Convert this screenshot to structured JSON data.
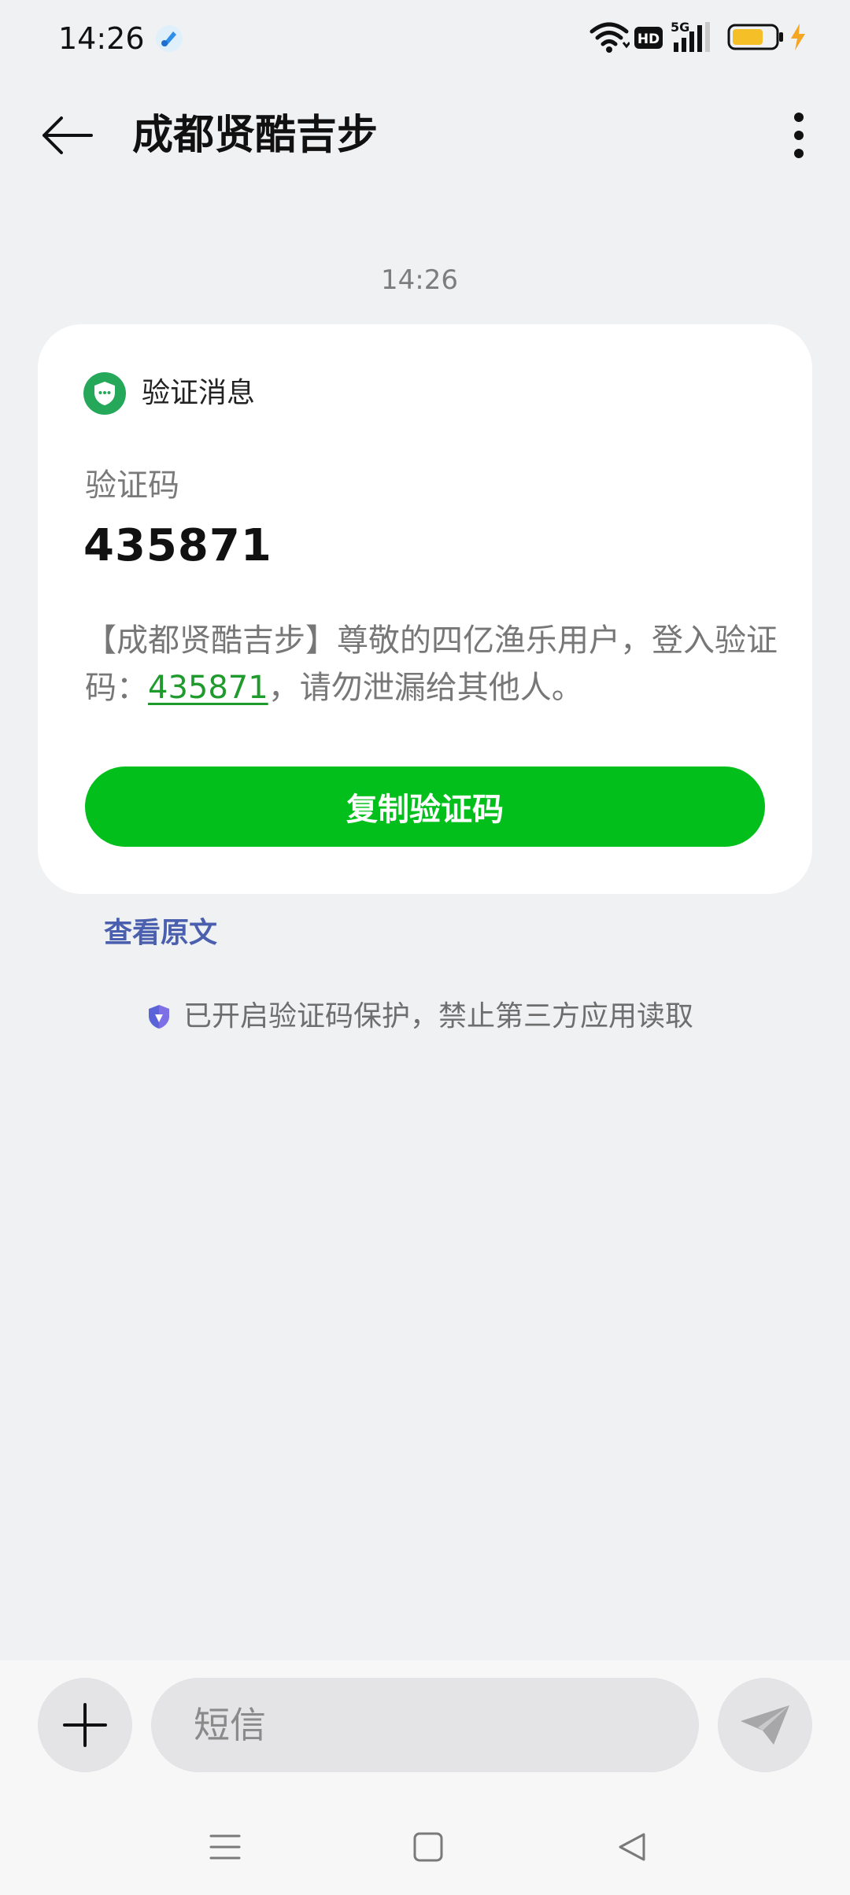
{
  "status_bar": {
    "time": "14:26",
    "network": "5G",
    "hd_label": "HD"
  },
  "header": {
    "title": "成都贤酷吉步"
  },
  "message": {
    "timestamp": "14:26",
    "card_label": "验证消息",
    "code_label": "验证码",
    "code_value": "435871",
    "body_prefix": "【成都贤酷吉步】尊敬的四亿渔乐用户，登入验证码：",
    "body_code": "435871",
    "body_suffix": "，请勿泄漏给其他人。",
    "copy_button": "复制验证码",
    "view_original": "查看原文",
    "protection_note": "已开启验证码保护，禁止第三方应用读取"
  },
  "composer": {
    "placeholder": "短信"
  },
  "colors": {
    "accent_green": "#02bf1c",
    "link_green": "#1f9a2c",
    "link_blue": "#4a5fae",
    "battery_yellow": "#f5c027"
  }
}
